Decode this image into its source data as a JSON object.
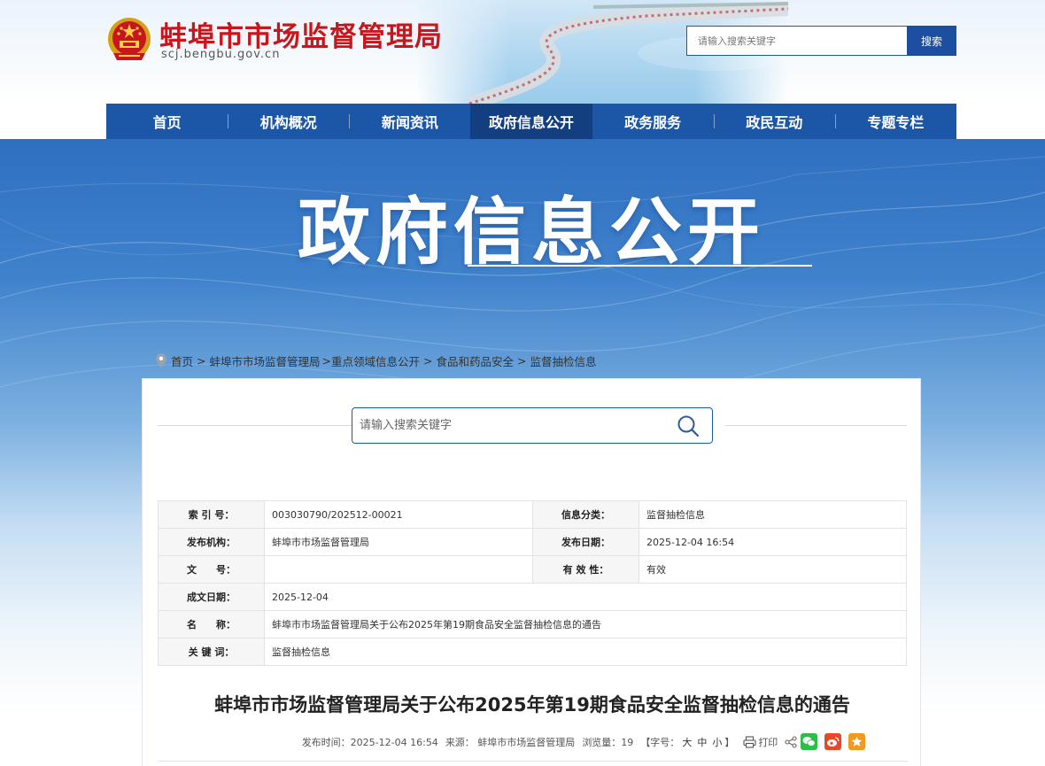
{
  "header": {
    "site_title": "蚌埠市市场监督管理局",
    "site_domain": "scj.bengbu.gov.cn",
    "search_placeholder": "请输入搜索关键字",
    "search_button": "搜索",
    "emblem_icon": "national-emblem-icon"
  },
  "nav": {
    "items": [
      {
        "label": "首页"
      },
      {
        "label": "机构概况"
      },
      {
        "label": "新闻资讯"
      },
      {
        "label": "政府信息公开",
        "active": true
      },
      {
        "label": "政务服务"
      },
      {
        "label": "政民互动"
      },
      {
        "label": "专题专栏"
      }
    ]
  },
  "banner": {
    "title": "政府信息公开"
  },
  "breadcrumb": {
    "items": [
      "首页",
      "蚌埠市市场监督管理局",
      "重点领域信息公开",
      "食品和药品安全",
      "监督抽检信息"
    ],
    "separator": ">"
  },
  "panel": {
    "search_placeholder": "请输入搜索关键字"
  },
  "meta": {
    "index_label": "索 引 号：",
    "index_value": "003030790/202512-00021",
    "category_label": "信息分类：",
    "category_value": "监督抽检信息",
    "publisher_label": "发布机构：",
    "publisher_value": "蚌埠市市场监督管理局",
    "publish_date_label": "发布日期：",
    "publish_date_value": "2025-12-04 16:54",
    "doc_no_label": "文　　号：",
    "doc_no_value": "",
    "validity_label": "有 效 性：",
    "validity_value": "有效",
    "created_label": "成文日期：",
    "created_value": "2025-12-04",
    "name_label": "名　　称：",
    "name_value": "蚌埠市市场监督管理局关于公布2025年第19期食品安全监督抽检信息的通告",
    "keyword_label": "关 键 词：",
    "keyword_value": "监督抽检信息"
  },
  "article": {
    "title": "蚌埠市市场监督管理局关于公布2025年第19期食品安全监督抽检信息的通告",
    "publish_time": "发布时间：2025-12-04 16:54",
    "source": "来源： 蚌埠市市场监督管理局",
    "views": "浏览量：19",
    "font_size_open": "【字号：",
    "font_large": "大",
    "font_medium": "中",
    "font_small": "小",
    "font_size_close": "】",
    "print": "打印"
  },
  "colors": {
    "brand_red": "#c8161d",
    "nav_blue": "#1c56a7",
    "nav_active": "#133f80",
    "wechat": "#2dbe4a",
    "weibo": "#e8482a",
    "favorite": "#f39a1e"
  }
}
